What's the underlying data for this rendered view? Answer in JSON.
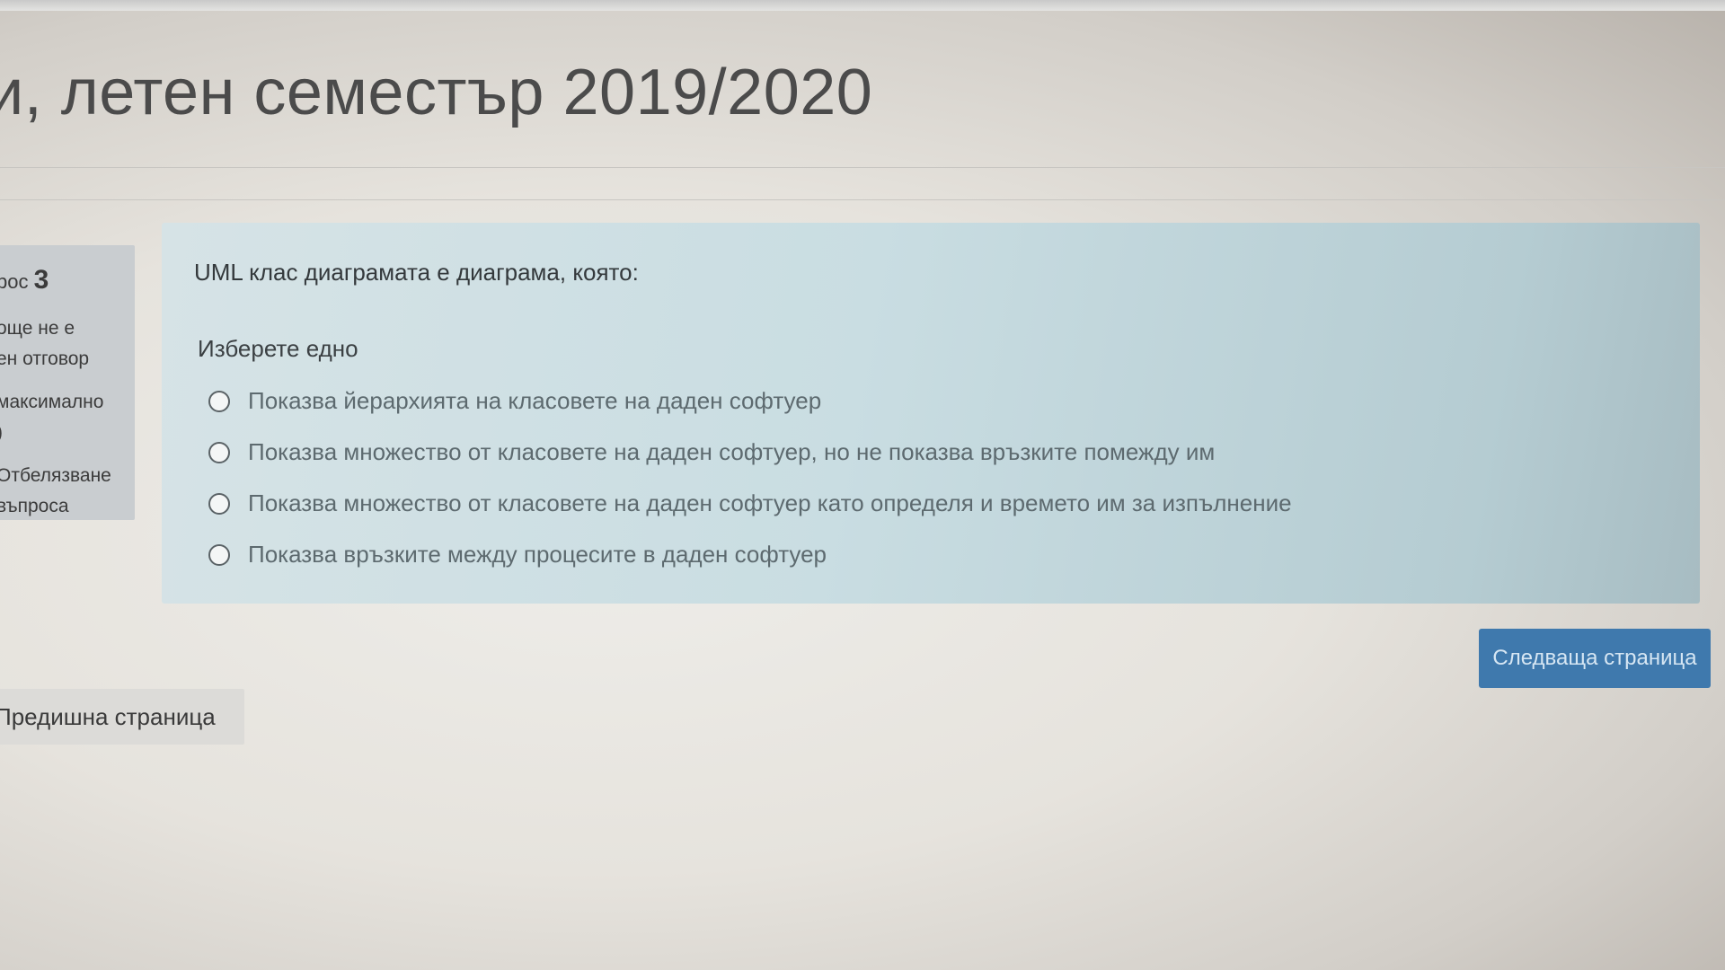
{
  "page": {
    "title": "и, летен семестър 2019/2020"
  },
  "info": {
    "question_label": "рос",
    "question_number": "3",
    "status_line1": "още не е",
    "status_line2": "ен отговор",
    "points_line1": "максимално",
    "points_line2": ")",
    "flag_line1": "Отбелязване",
    "flag_line2": "въпроса"
  },
  "question": {
    "text": "UML клас диаграмата е диаграма, която:",
    "prompt": "Изберете едно",
    "answers": [
      {
        "label": "Показва йерархията на класовете на даден софтуер"
      },
      {
        "label": "Показва множество от класовете на даден софтуер, но не показва връзките помежду им"
      },
      {
        "label": "Показва множество от класовете на даден софтуер като определя и времето им за изпълнение"
      },
      {
        "label": "Показва връзките между процесите в даден софтуер"
      }
    ]
  },
  "navigation": {
    "next_label": "Следваща страница",
    "prev_label": "Предишна страница"
  },
  "colors": {
    "question_background": "#c9dde2",
    "info_background": "#c9cdd0",
    "next_button": "#3f79ad"
  }
}
